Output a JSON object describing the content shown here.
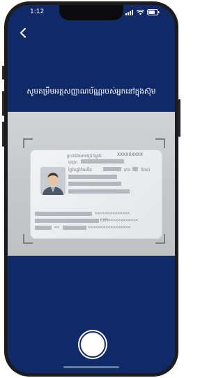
{
  "status_bar": {
    "time": "1:12",
    "icons": [
      "signal-icon",
      "wifi-icon",
      "battery-icon"
    ]
  },
  "scanner": {
    "back_icon": "chevron-left-icon",
    "instruction": "សូមតម្រឹមអត្តសញ្ញាណប័ណ្ណរបស់អ្នកនៅក្នុងស៊ុម",
    "shutter_icon": "shutter-icon"
  },
  "id_card": {
    "country": "ព្រះរាជាណាចក្រកម្ពុជា",
    "card_number": "XXXXXXXXX",
    "name_label": "ឈ្មោះ",
    "dob_label": "ថ្ងៃខែឆ្នាំកំណើត",
    "sex_label": "ភេទ",
    "height_label": "កំពស់",
    "mrz_line_1": "<<<<<<<<<<<<<<",
    "mrz_line_2": "KHM<<<<<<<<<<<<",
    "mrz_line_3": "<<<<<<<<<<<<<<<<<",
    "mrz_prefix": "<<"
  },
  "colors": {
    "background": "#0f2a66",
    "scan_area": "#c6c8cc",
    "text": "#ffffff"
  }
}
